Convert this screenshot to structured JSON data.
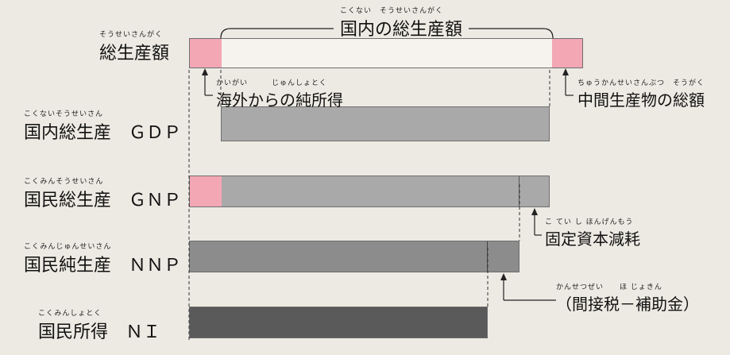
{
  "title": {
    "ruby": "こくない　そうせいさんがく",
    "text": "国内の総生産額"
  },
  "rows": [
    {
      "id": "total",
      "ruby": "そうせいさんがく",
      "label": "総生産額"
    },
    {
      "id": "gdp",
      "ruby": "こくないそうせいさん",
      "label": "国内総生産　ＧＤＰ"
    },
    {
      "id": "gnp",
      "ruby": "こくみんそうせいさん",
      "label": "国民総生産　ＧＮＰ"
    },
    {
      "id": "nnp",
      "ruby": "こくみんじゅんせいさん",
      "label": "国民純生産　ＮＮＰ"
    },
    {
      "id": "ni",
      "ruby": "こくみんしょとく",
      "label": "国民所得　ＮＩ"
    }
  ],
  "annotations": {
    "foreign_income": {
      "ruby": "かいがい　　　じゅんしょとく",
      "text": "海外からの純所得"
    },
    "intermediate": {
      "ruby": "ちゅうかんせいさんぶつ　そうがく",
      "text": "中間生産物の総額"
    },
    "depreciation": {
      "ruby": "こ てい し ほんげんもう",
      "text": "固定資本減耗"
    },
    "indirect_tax": {
      "ruby": "かんせつぜい　　ほ じょきん",
      "text": "（間接税－補助金）"
    }
  },
  "colors": {
    "foreign_income": "#f3a7b5",
    "light_gray": "#a9a9a9",
    "mid_gray": "#8c8c8c",
    "dark_gray": "#5a5a5a",
    "background": "#edeae3"
  }
}
